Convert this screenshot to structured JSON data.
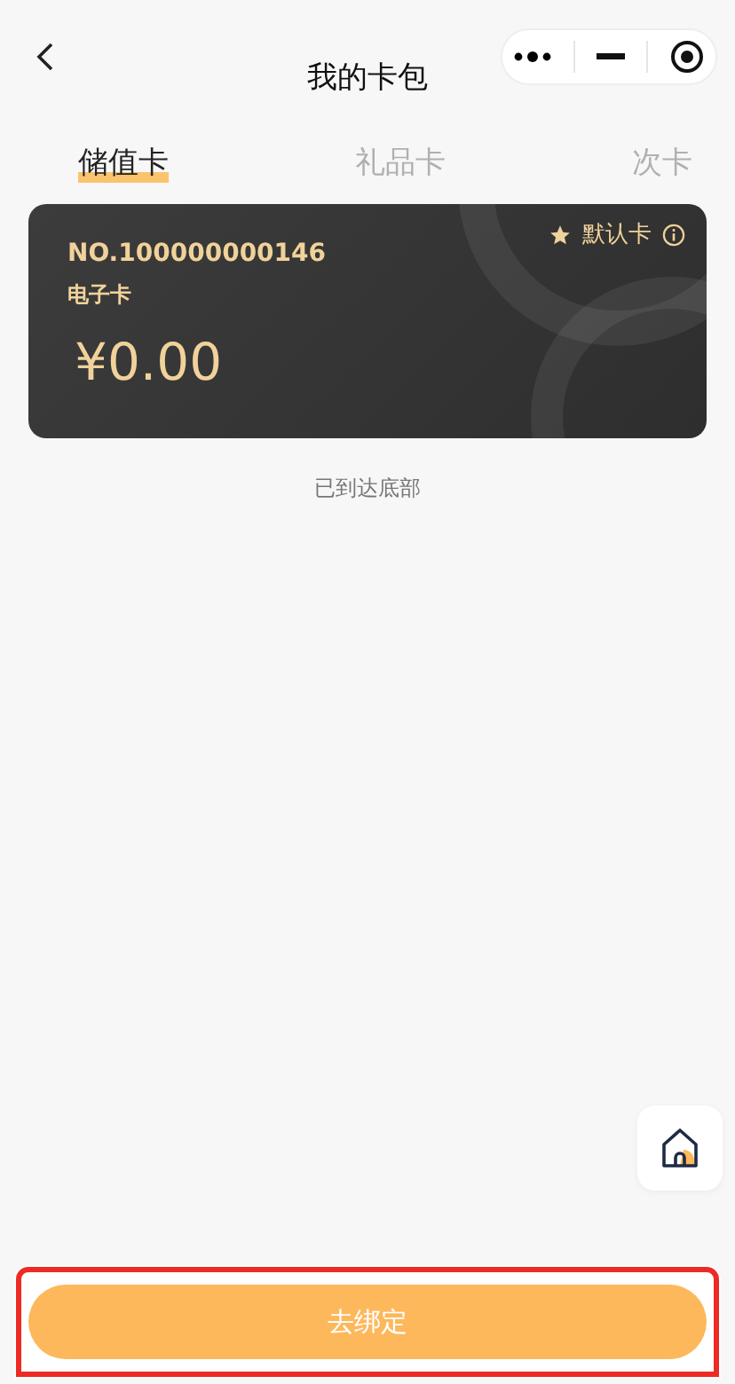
{
  "header": {
    "title": "我的卡包"
  },
  "tabs": [
    {
      "label": "储值卡",
      "selected": true
    },
    {
      "label": "礼品卡",
      "selected": false
    },
    {
      "label": "次卡",
      "selected": false
    }
  ],
  "cards": [
    {
      "number": "NO.100000000146",
      "type": "电子卡",
      "balance": "¥0.00",
      "default_label": "默认卡"
    }
  ],
  "end_note": "已到达底部",
  "bottom_button": {
    "label": "去绑定",
    "highlighted": true
  }
}
